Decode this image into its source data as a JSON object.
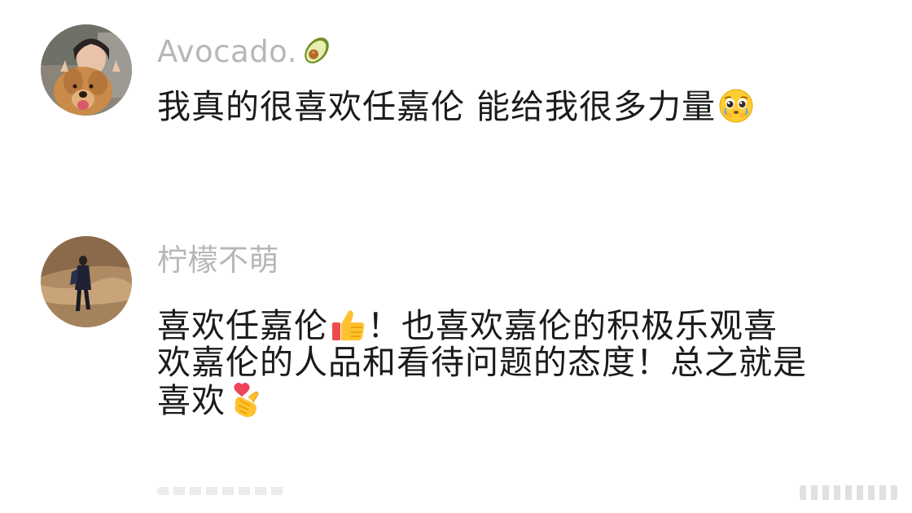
{
  "comments": [
    {
      "username": "Avocado.",
      "username_icon": "avocado-icon",
      "avatar": "girl-with-golden-retriever-photo",
      "text_lines": [
        "我真的很喜欢任嘉伦 能给我很多力量"
      ],
      "emoji": "pleading-face-emoji"
    },
    {
      "username": "柠檬不萌",
      "avatar": "person-on-hillside-photo",
      "text_lines": [
        "喜欢任嘉伦",
        "！也喜欢嘉伦的积极乐观喜",
        "欢嘉伦的人品和看待问题的态度！总之就是",
        "喜欢"
      ],
      "emojis": [
        "thumbs-up-emoji",
        "finger-heart-emoji"
      ]
    }
  ],
  "colors": {
    "username": "#b7b7b7",
    "text": "#1b1b1b",
    "background": "#ffffff"
  }
}
